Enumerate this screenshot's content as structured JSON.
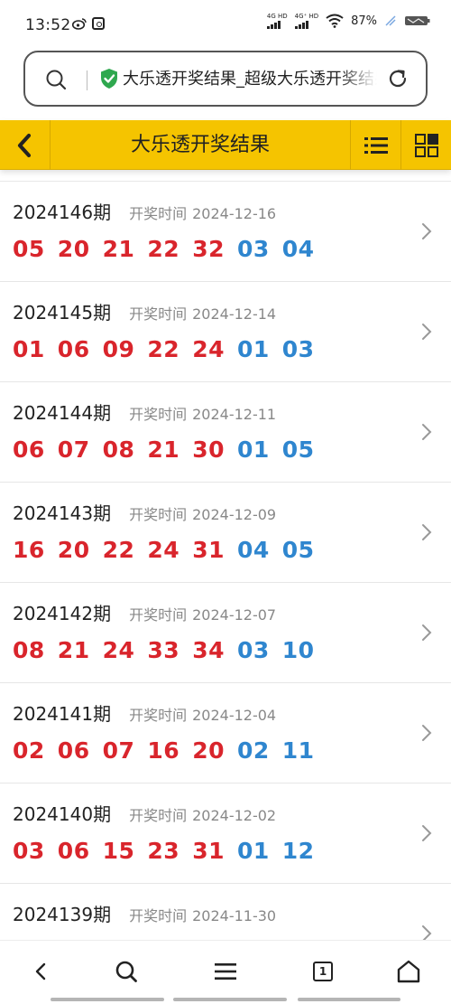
{
  "status_bar": {
    "time": "13:52",
    "net1_label": "4G HD",
    "net2_label": "4G⁺ HD",
    "battery": "87%",
    "icons": [
      "weibo-icon",
      "app-badge-icon",
      "signal-icon",
      "wifi-icon",
      "charging-icon",
      "battery-icon"
    ]
  },
  "address_bar": {
    "url_text": "大乐透开奖结果_超级大乐透开奖结果",
    "icons": [
      "search-icon",
      "shield-check-icon",
      "reload-icon"
    ]
  },
  "header": {
    "title": "大乐透开奖结果",
    "icons": [
      "back-chevron-icon",
      "list-menu-icon",
      "grid-icon"
    ]
  },
  "results": [
    {
      "issue": "2024146期",
      "date_label": "开奖时间",
      "date": "2024-12-16",
      "red": [
        "05",
        "20",
        "21",
        "22",
        "32"
      ],
      "blue": [
        "03",
        "04"
      ]
    },
    {
      "issue": "2024145期",
      "date_label": "开奖时间",
      "date": "2024-12-14",
      "red": [
        "01",
        "06",
        "09",
        "22",
        "24"
      ],
      "blue": [
        "01",
        "03"
      ]
    },
    {
      "issue": "2024144期",
      "date_label": "开奖时间",
      "date": "2024-12-11",
      "red": [
        "06",
        "07",
        "08",
        "21",
        "30"
      ],
      "blue": [
        "01",
        "05"
      ]
    },
    {
      "issue": "2024143期",
      "date_label": "开奖时间",
      "date": "2024-12-09",
      "red": [
        "16",
        "20",
        "22",
        "24",
        "31"
      ],
      "blue": [
        "04",
        "05"
      ]
    },
    {
      "issue": "2024142期",
      "date_label": "开奖时间",
      "date": "2024-12-07",
      "red": [
        "08",
        "21",
        "24",
        "33",
        "34"
      ],
      "blue": [
        "03",
        "10"
      ]
    },
    {
      "issue": "2024141期",
      "date_label": "开奖时间",
      "date": "2024-12-04",
      "red": [
        "02",
        "06",
        "07",
        "16",
        "20"
      ],
      "blue": [
        "02",
        "11"
      ]
    },
    {
      "issue": "2024140期",
      "date_label": "开奖时间",
      "date": "2024-12-02",
      "red": [
        "03",
        "06",
        "15",
        "23",
        "31"
      ],
      "blue": [
        "01",
        "12"
      ]
    },
    {
      "issue": "2024139期",
      "date_label": "开奖时间",
      "date": "2024-11-30",
      "red": [],
      "blue": []
    }
  ],
  "colors": {
    "header_bg": "#f5c400",
    "red_ball": "#d9252c",
    "blue_ball": "#2f86cf"
  },
  "bottom_nav": {
    "tab_count": "1",
    "icons": [
      "back-icon",
      "search-icon",
      "menu-icon",
      "tabs-icon",
      "home-icon"
    ]
  }
}
